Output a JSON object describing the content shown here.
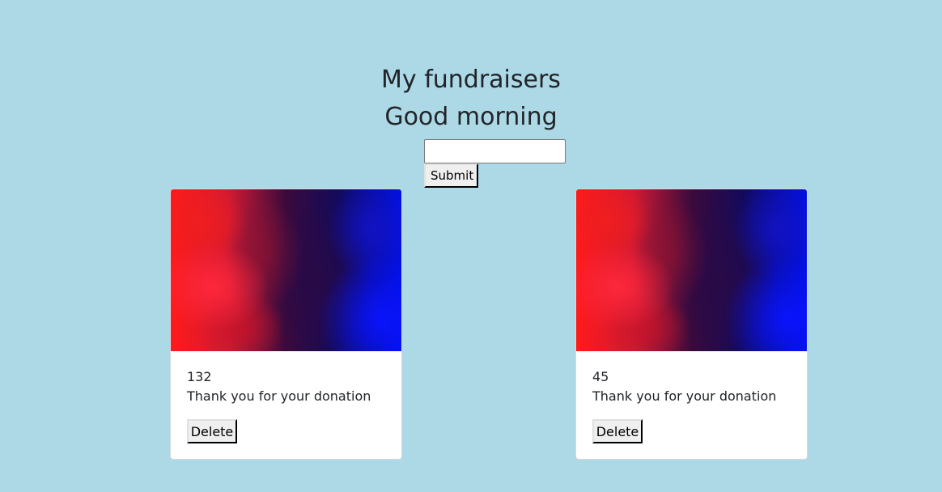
{
  "header": {
    "title": "My fundraisers",
    "greeting": "Good morning"
  },
  "form": {
    "input_value": "",
    "submit_label": "Submit"
  },
  "cards": [
    {
      "amount": "132",
      "message": "Thank you for your donation",
      "delete_label": "Delete"
    },
    {
      "amount": "45",
      "message": "Thank you for your donation",
      "delete_label": "Delete"
    }
  ],
  "colors": {
    "background": "#add8e6",
    "card_background": "#ffffff",
    "text": "#212529"
  }
}
